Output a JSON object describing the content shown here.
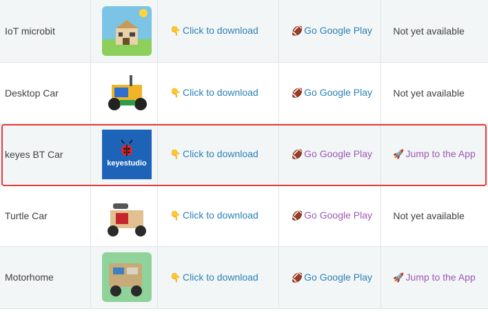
{
  "rows": [
    {
      "name": "IoT microbit",
      "download": "Click to download",
      "google": "Go Google Play",
      "app": "Not yet available",
      "app_link": false
    },
    {
      "name": "Desktop Car",
      "download": "Click to download",
      "google": "Go Google Play",
      "app": "Not yet available",
      "app_link": false
    },
    {
      "name": "keyes BT Car",
      "download": "Click to download",
      "google": "Go Google Play",
      "app": "Jump to the App",
      "app_link": true
    },
    {
      "name": "Turtle Car",
      "download": "Click to download",
      "google": "Go Google Play",
      "app": "Not yet available",
      "app_link": false
    },
    {
      "name": "Motorhome",
      "download": "Click to download",
      "google": "Go Google Play",
      "app": "Jump to the App",
      "app_link": true
    }
  ],
  "icons": {
    "download": "pointing-down-hand-icon",
    "google": "football-icon",
    "app": "rocket-icon"
  },
  "logo_text": "keyestudio",
  "colors": {
    "link": "#2980b9",
    "visited": "#9b59b6",
    "highlight": "#e63b3b"
  }
}
